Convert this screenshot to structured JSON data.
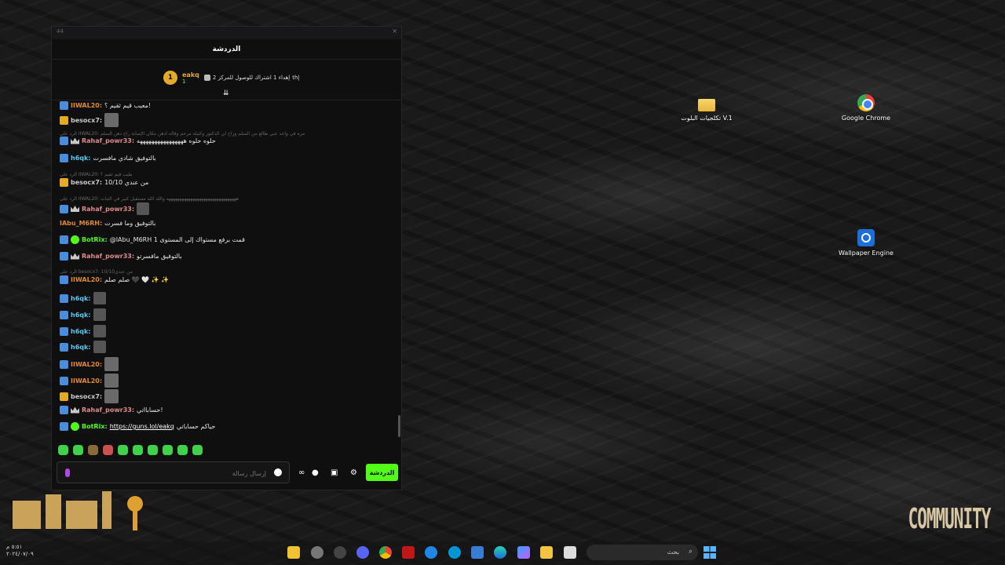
{
  "window": {
    "num": "44",
    "close": "×",
    "title": "الدردشة"
  },
  "pinned": {
    "level": "1",
    "user": "eakq",
    "count": "1",
    "goal_prefix": "th|",
    "goal_text": "إهداء 1 اشتراك للوصول للمركز 2",
    "collapse": "⇊"
  },
  "messages": [
    {
      "reply": "",
      "user": "IIWAL20:",
      "text": "معیب قیم ثقیم ؟!",
      "color": "#e08a2e",
      "badges": "mod"
    },
    {
      "reply": "",
      "user": "besocx7:",
      "text": "",
      "color": "#c9c9c9",
      "badges": "vip",
      "emote": true
    },
    {
      "reply": "الرد على IIWAL20: مره في واحد عبي طالع من السلم وزاح لي الدكتور وكتبلة مرحم وقاله ادهن مكان الإصابة راح دهن السلم",
      "user": "",
      "text": "",
      "color": "",
      "badges": ""
    },
    {
      "reply": "",
      "user": "Rahaf_powr33:",
      "text": "حلوه حلوه ههههههههههههههههه",
      "color": "#e08a8a",
      "badges": "mod-crown"
    },
    {
      "reply": "",
      "user": "h6qk:",
      "text": "بالتوفيق شادي مافسرت",
      "color": "#5ec8f0",
      "badges": "mod"
    },
    {
      "reply": "الرد على IIWAL20: طيب قيم ثقيم ؟",
      "user": "",
      "text": "",
      "color": "",
      "badges": ""
    },
    {
      "reply": "",
      "user": "besocx7:",
      "text": "من عندي 10/10",
      "color": "#c9c9c9",
      "badges": "vip"
    },
    {
      "reply": "الرد على IIWAL20: ههههههههههههههههههههههههههههههههه والله الله مستقبل كبير في الثبات",
      "user": "",
      "text": "",
      "color": "",
      "badges": ""
    },
    {
      "reply": "",
      "user": "Rahaf_powr33:",
      "text": "",
      "color": "#e08a8a",
      "badges": "mod-crown",
      "emote": true
    },
    {
      "reply": "",
      "user": "IAbu_M6RH:",
      "text": "بالتوفيق وما فسرت",
      "color": "#e08a2e",
      "badges": ""
    },
    {
      "reply": "",
      "user": "BotRix:",
      "text": "@IAbu_M6RH قمت برفع مستواك إلى المستوى 1",
      "color": "#53fc18",
      "badges": "mod-bot"
    },
    {
      "reply": "",
      "user": "Rahaf_powr33:",
      "text": "بالتوفيق مافسرتو",
      "color": "#e08a8a",
      "badges": "mod-crown"
    },
    {
      "reply": "الرد على besocx7: 10/10من عندي",
      "user": "",
      "text": "",
      "color": "",
      "badges": ""
    },
    {
      "reply": "",
      "user": "IIWAL20:",
      "text": "صلم صلم 🖤 🤍 ✨ ✨",
      "color": "#e08a2e",
      "badges": "mod"
    },
    {
      "reply": "",
      "user": "h6qk:",
      "text": "",
      "color": "#5ec8f0",
      "badges": "mod",
      "emote": true
    },
    {
      "reply": "",
      "user": "h6qk:",
      "text": "",
      "color": "#5ec8f0",
      "badges": "mod",
      "emote": true
    },
    {
      "reply": "",
      "user": "h6qk:",
      "text": "",
      "color": "#5ec8f0",
      "badges": "mod",
      "emote": true
    },
    {
      "reply": "",
      "user": "h6qk:",
      "text": "",
      "color": "#5ec8f0",
      "badges": "mod",
      "emote": true
    },
    {
      "reply": "",
      "user": "IIWAL20:",
      "text": "",
      "color": "#e08a2e",
      "badges": "mod",
      "emote": true
    },
    {
      "reply": "",
      "user": "IIWAL20:",
      "text": "",
      "color": "#e08a2e",
      "badges": "mod",
      "emote": true
    },
    {
      "reply": "",
      "user": "besocx7:",
      "text": "",
      "color": "#c9c9c9",
      "badges": "vip",
      "emote": true
    },
    {
      "reply": "",
      "user": "Rahaf_powr33:",
      "text": "حسابااتي!",
      "color": "#e08a8a",
      "badges": "mod-crown"
    },
    {
      "reply": "",
      "user": "BotRix:",
      "text": "حياكم حساباتي",
      "link": "https://guns.lol/eakq",
      "color": "#53fc18",
      "badges": "mod-bot"
    }
  ],
  "input": {
    "placeholder": "إرسال رسالة"
  },
  "send_label": "الدردشة",
  "desktop_icons": [
    {
      "label": "تكلجيات البلوت V.1",
      "icon": "folder-icon"
    },
    {
      "label": "Google Chrome",
      "icon": "chrome-icon"
    },
    {
      "label": "Wallpaper Engine",
      "icon": "wallpaper-engine-icon"
    }
  ],
  "community_logo": "COMMUNITY",
  "taskbar": {
    "search_label": "بحث",
    "clock_time": "٥:٥١ م",
    "clock_date": "٢٠٢٤/٠٧/٠٩"
  },
  "colors": {
    "accent": "#53fc18",
    "background": "#0f0f10"
  }
}
